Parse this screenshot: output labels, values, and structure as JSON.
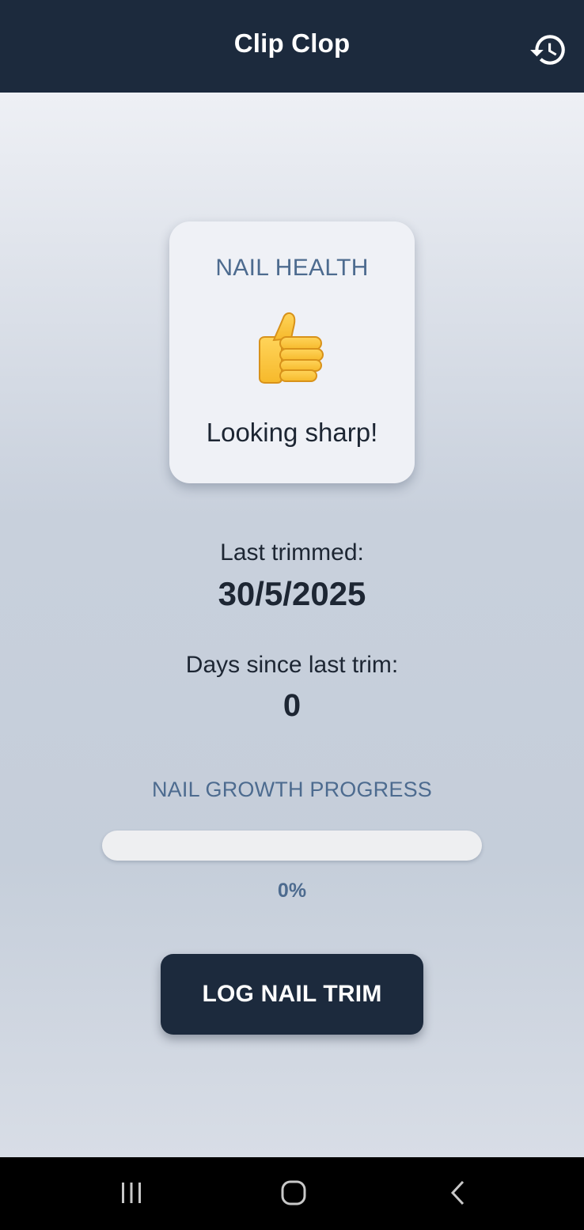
{
  "app_bar": {
    "title": "Clip Clop",
    "history_icon": "history-icon",
    "background_color": "#1c2a3d"
  },
  "health_card": {
    "title": "NAIL HEALTH",
    "icon": "thumbs-up-icon",
    "status": "Looking sharp!"
  },
  "last_trimmed": {
    "label": "Last trimmed:",
    "value": "30/5/2025"
  },
  "days_since": {
    "label": "Days since last trim:",
    "value": "0"
  },
  "growth_progress": {
    "label": "NAIL GROWTH PROGRESS",
    "percent_text": "0%",
    "fraction": 0,
    "accent_color": "#4d6b8f"
  },
  "actions": {
    "log_trim_label": "LOG NAIL TRIM"
  },
  "system_nav": {
    "icons": [
      "recent-apps-icon",
      "home-icon",
      "back-icon"
    ]
  }
}
